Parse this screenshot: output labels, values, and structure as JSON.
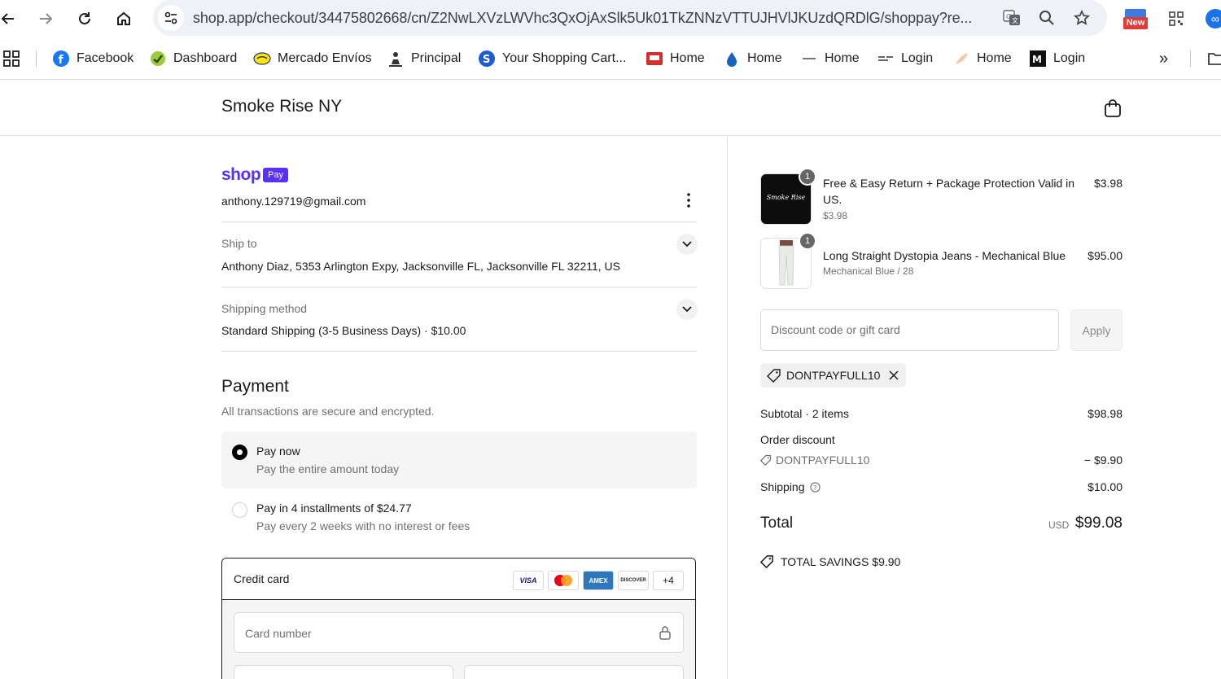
{
  "browser": {
    "url": "shop.app/checkout/34475802668/cn/Z2NwLXVzLWVhc3QxOjAxSlk5Uk01TkZNNzVTTUJHVlJKUzdQRDlG/shoppay?re...",
    "new_badge": "New",
    "bookmarks": [
      {
        "label": "Facebook",
        "icon": "facebook-icon"
      },
      {
        "label": "Dashboard",
        "icon": "dashboard-icon"
      },
      {
        "label": "Mercado Envíos",
        "icon": "mercado-icon"
      },
      {
        "label": "Principal",
        "icon": "principal-icon"
      },
      {
        "label": "Your Shopping Cart...",
        "icon": "cart-site-icon"
      },
      {
        "label": "Home",
        "icon": "home-site-icon"
      },
      {
        "label": "Home",
        "icon": "drop-icon"
      },
      {
        "label": "Home",
        "icon": "dash-icon"
      },
      {
        "label": "Login",
        "icon": "login-site-icon"
      },
      {
        "label": "Home",
        "icon": "feather-icon"
      },
      {
        "label": "Login",
        "icon": "m-logo-icon"
      }
    ],
    "overflow": "»"
  },
  "store": {
    "name": "Smoke Rise NY"
  },
  "contact": {
    "brand_word": "shop",
    "brand_badge": "Pay",
    "email": "anthony.129719@gmail.com"
  },
  "ship_to": {
    "label": "Ship to",
    "value": "Anthony Diaz, 5353 Arlington Expy, Jacksonville FL, Jacksonville FL 32211, US"
  },
  "shipping_method": {
    "label": "Shipping method",
    "value": "Standard Shipping (3-5 Business Days) · $10.00"
  },
  "payment": {
    "title": "Payment",
    "subtitle": "All transactions are secure and encrypted.",
    "options": [
      {
        "title": "Pay now",
        "subtitle": "Pay the entire amount today",
        "selected": true
      },
      {
        "title": "Pay in 4 installments of $24.77",
        "subtitle": "Pay every 2 weeks with no interest or fees",
        "selected": false
      }
    ],
    "credit_card_label": "Credit card",
    "card_brands": [
      "VISA",
      "MC",
      "AMEX",
      "DISCOVER",
      "+4"
    ],
    "card_number_placeholder": "Card number"
  },
  "order": {
    "items": [
      {
        "name": "Free & Easy Return + Package Protection Valid in US.",
        "sub": "$3.98",
        "price": "$3.98",
        "qty": "1",
        "thumb_text": "Smoke Rise"
      },
      {
        "name": "Long Straight Dystopia Jeans - Mechanical Blue",
        "sub": "Mechanical Blue / 28",
        "price": "$95.00",
        "qty": "1"
      }
    ],
    "discount_placeholder": "Discount code or gift card",
    "apply_label": "Apply",
    "applied_code": "DONTPAYFULL10",
    "subtotal_label": "Subtotal · 2 items",
    "subtotal_value": "$98.98",
    "order_discount_label": "Order discount",
    "discount_code": "DONTPAYFULL10",
    "discount_value": "− $9.90",
    "shipping_label": "Shipping",
    "shipping_value": "$10.00",
    "total_label": "Total",
    "currency": "USD",
    "total_value": "$99.08",
    "savings": "TOTAL SAVINGS  $9.90"
  }
}
